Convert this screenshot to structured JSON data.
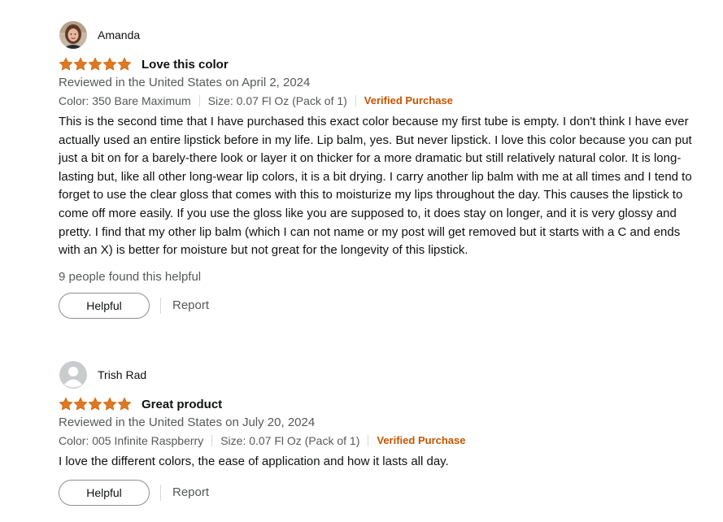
{
  "reviews": [
    {
      "name": "Amanda",
      "avatar": "photo-avatar",
      "rating": 5,
      "title": "Love this color",
      "reviewed": "Reviewed in the United States on April 2, 2024",
      "color": "Color: 350 Bare Maximum",
      "size": "Size: 0.07 Fl Oz (Pack of 1)",
      "verified": "Verified Purchase",
      "body": "This is the second time that I have purchased this exact color because my first tube is empty. I don't think I have ever actually used an entire lipstick before in my life. Lip balm, yes. But never lipstick. I love this color because you can put just a bit on for a barely-there look or layer it on thicker for a more dramatic but still relatively natural color. It is long-lasting but, like all other long-wear lip colors, it is a bit drying. I carry another lip balm with me at all times and I tend to forget to use the clear gloss that comes with this to moisturize my lips throughout the day. This causes the lipstick to come off more easily. If you use the gloss like you are supposed to, it does stay on longer, and it is very glossy and pretty. I find that my other lip balm (which I can not name or my post will get removed but it starts with a C and ends with an X) is better for moisture but not great for the longevity of this lipstick.",
      "helpful_count": "9 people found this helpful",
      "helpful_label": "Helpful",
      "report_label": "Report"
    },
    {
      "name": "Trish Rad",
      "avatar": "default-user-avatar",
      "rating": 5,
      "title": "Great product",
      "reviewed": "Reviewed in the United States on July 20, 2024",
      "color": "Color: 005 Infinite Raspberry",
      "size": "Size: 0.07 Fl Oz (Pack of 1)",
      "verified": "Verified Purchase",
      "body": "I love the different colors, the ease of application and how it lasts all day.",
      "helpful_label": "Helpful",
      "report_label": "Report"
    }
  ],
  "colors": {
    "star": "#de7921",
    "verified": "#c45500",
    "meta": "#565959"
  }
}
